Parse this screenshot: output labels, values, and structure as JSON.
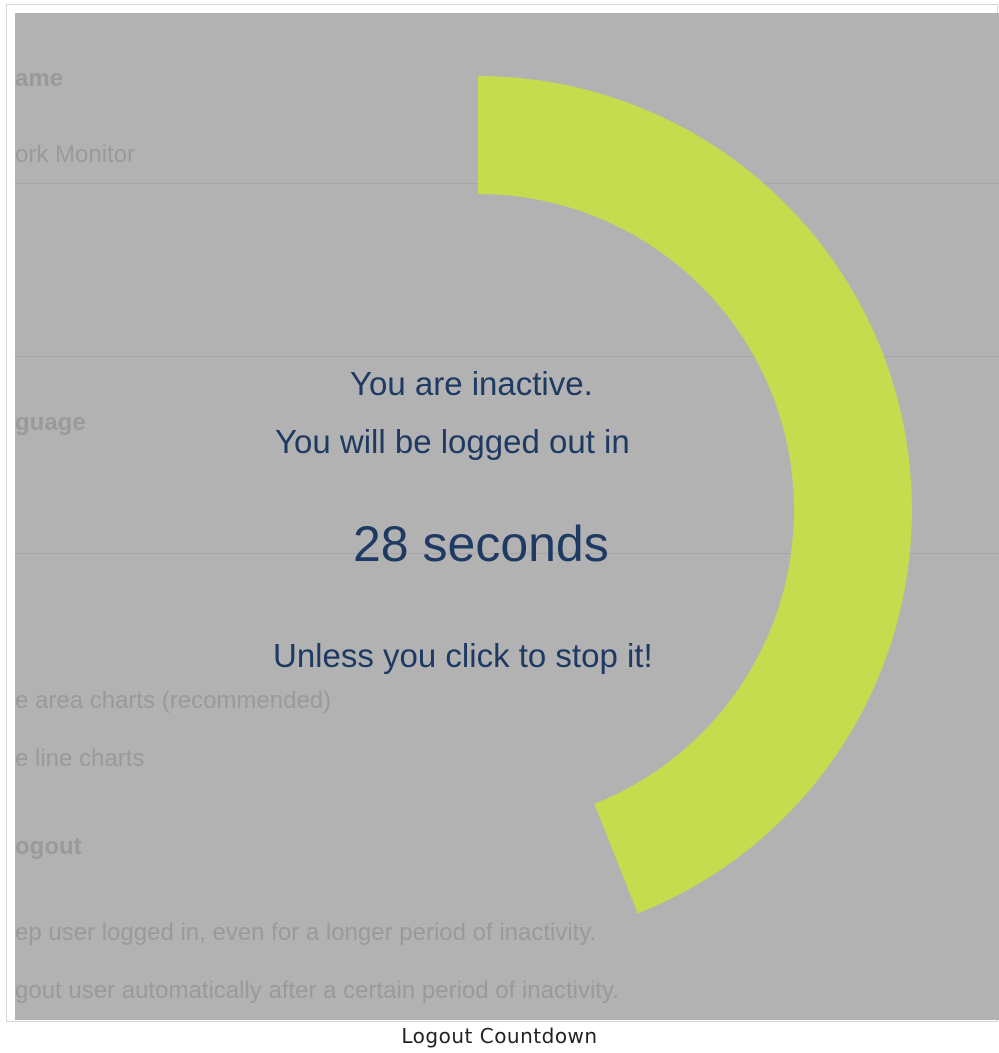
{
  "background": {
    "name_label": "ame",
    "name_value": "ork Monitor",
    "language_label": "guage",
    "chart_option_1": "e area charts (recommended)",
    "chart_option_2": "e line charts",
    "logout_label": "ogout",
    "logout_option_1": "ep user logged in, even for a longer period of inactivity.",
    "logout_option_2": "gout user automatically after a certain period of inactivity."
  },
  "dialog": {
    "line1": "You are inactive.",
    "line2": "You will be logged out in",
    "countdown": "28 seconds",
    "line4": "Unless you click to stop it!",
    "progress_fraction": 0.44,
    "ring_color": "#c5dc4f",
    "text_color": "#1e3a63"
  },
  "caption": "Logout Countdown"
}
